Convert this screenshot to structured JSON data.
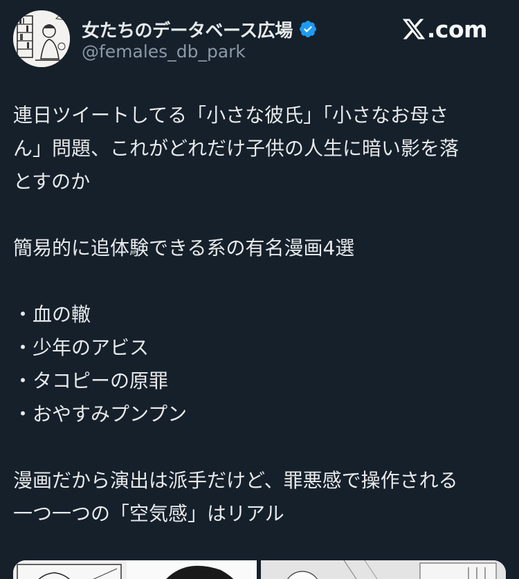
{
  "author": {
    "display_name": "女たちのデータベース広場",
    "handle": "@females_db_park",
    "verified": true,
    "verified_color": "#1d9bf0"
  },
  "brand": {
    "icon": "x-logo-icon",
    "text": ".com"
  },
  "tweet": {
    "lines": [
      "連日ツイートしてる「小さな彼氏」「小さなお母さ",
      "ん」問題、これがどれだけ子供の人生に暗い影を落",
      "とすのか",
      "",
      "簡易的に追体験できる系の有名漫画4選",
      "",
      "・血の轍",
      "・少年のアビス",
      "・タコピーの原罪",
      "・おやすみプンプン",
      "",
      "漫画だから演出は派手だけど、罪悪感で操作される",
      "一つ一つの「空気感」はリアル"
    ]
  },
  "colors": {
    "background": "#15202b",
    "text": "#e7e9ea",
    "secondary_text": "#8b98a5"
  }
}
